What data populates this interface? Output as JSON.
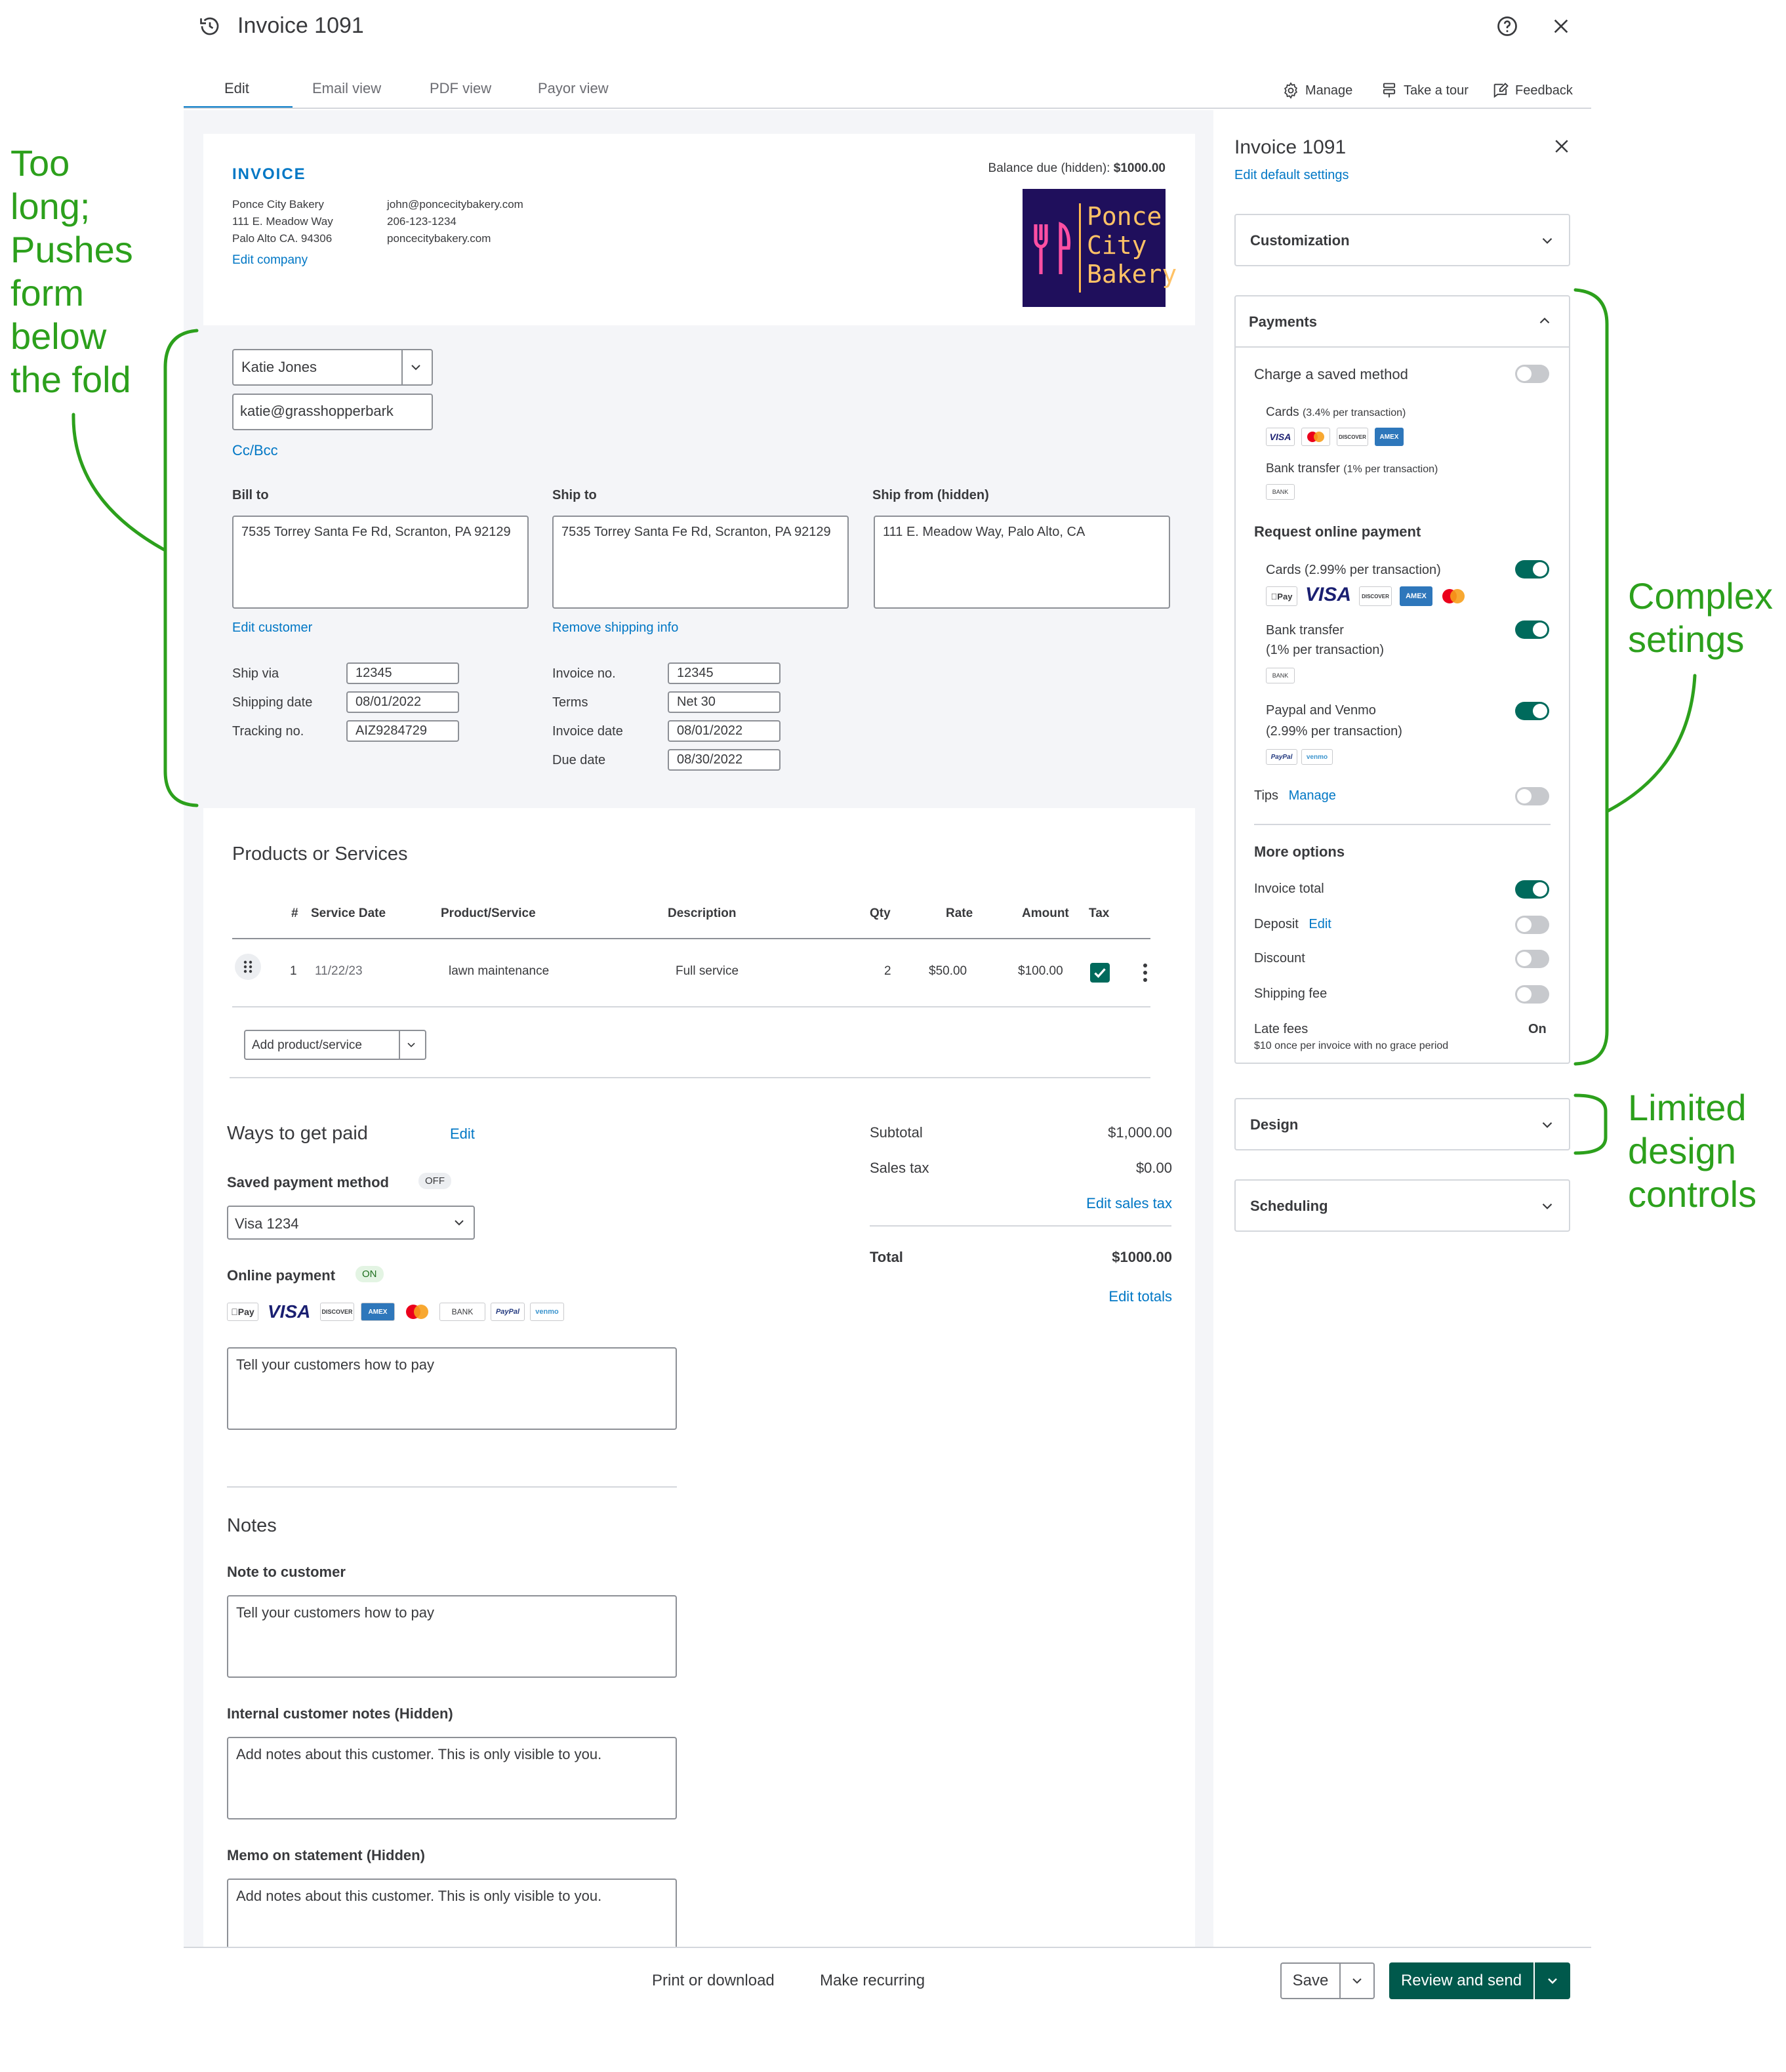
{
  "header": {
    "title": "Invoice 1091",
    "tabs": [
      "Edit",
      "Email view",
      "PDF view",
      "Payor view"
    ],
    "tools": {
      "manage": "Manage",
      "tour": "Take a tour",
      "feedback": "Feedback"
    }
  },
  "company": {
    "heading": "INVOICE",
    "name": "Ponce City Bakery",
    "address1": "111 E. Meadow Way",
    "address2": "Palo Alto CA. 94306",
    "email": "john@poncecitybakery.com",
    "phone": "206-123-1234",
    "site": "poncecitybakery.com",
    "edit": "Edit company",
    "balance_label": "Balance due (hidden):",
    "balance_value": "$1000.00",
    "logo": [
      "Ponce",
      "City",
      "Bakery"
    ]
  },
  "customer": {
    "name": "Katie Jones",
    "email": "katie@grasshopperbark",
    "ccbcc": "Cc/Bcc",
    "bill_to_label": "Bill to",
    "bill_to": "7535 Torrey Santa Fe Rd, Scranton, PA 92129",
    "ship_to_label": "Ship to",
    "ship_to": "7535 Torrey Santa Fe Rd, Scranton, PA 92129",
    "ship_from_label": "Ship from (hidden)",
    "ship_from": "111 E. Meadow Way, Palo Alto, CA",
    "edit_customer": "Edit customer",
    "remove_shipping": "Remove shipping info"
  },
  "shipping": {
    "via_label": "Ship via",
    "via": "12345",
    "date_label": "Shipping date",
    "date": "08/01/2022",
    "tracking_label": "Tracking no.",
    "tracking": "AIZ9284729"
  },
  "invoice_meta": {
    "no_label": "Invoice no.",
    "no": "12345",
    "terms_label": "Terms",
    "terms": "Net 30",
    "date_label": "Invoice date",
    "date": "08/01/2022",
    "due_label": "Due date",
    "due": "08/30/2022"
  },
  "products": {
    "title": "Products or Services",
    "columns": [
      "#",
      "Service Date",
      "Product/Service",
      "Description",
      "Qty",
      "Rate",
      "Amount",
      "Tax"
    ],
    "rows": [
      {
        "num": "1",
        "date": "11/22/23",
        "product": "lawn maintenance",
        "description": "Full service",
        "qty": "2",
        "rate": "$50.00",
        "amount": "$100.00"
      }
    ],
    "add": "Add product/service"
  },
  "payment": {
    "title": "Ways to get paid",
    "edit": "Edit",
    "saved_label": "Saved payment method",
    "saved_badge": "OFF",
    "saved_value": "Visa 1234",
    "online_label": "Online payment",
    "online_badge": "ON",
    "methods": [
      "Pay",
      "VISA",
      "DISCOVER",
      "AMEX",
      "BANK",
      "PayPal",
      "venmo"
    ],
    "instructions_placeholder": "Tell your customers how to pay"
  },
  "totals": {
    "subtotal_label": "Subtotal",
    "subtotal": "$1,000.00",
    "tax_label": "Sales tax",
    "tax": "$0.00",
    "edit_tax": "Edit sales tax",
    "total_label": "Total",
    "total": "$1000.00",
    "edit_totals": "Edit totals"
  },
  "notes": {
    "title": "Notes",
    "customer_label": "Note to customer",
    "customer_placeholder": "Tell your customers how to pay",
    "internal_label": "Internal customer notes (Hidden)",
    "internal_placeholder": "Add notes about this customer. This is only visible to you.",
    "memo_label": "Memo on statement (Hidden)",
    "memo_placeholder": "Add notes about this customer. This is only visible to you."
  },
  "sidebar": {
    "title": "Invoice 1091",
    "edit_defaults": "Edit default settings",
    "customization": "Customization",
    "payments": "Payments",
    "charge_saved": "Charge a saved method",
    "cards": "Cards",
    "cards_fee": "(3.4% per transaction)",
    "bank": "Bank transfer",
    "bank_fee": "(1% per transaction)",
    "request_online": "Request online payment",
    "online_cards": "Cards",
    "online_cards_fee": "(2.99% per transaction)",
    "online_bank": "Bank transfer",
    "online_bank_fee": "(1% per transaction)",
    "paypal": "Paypal and Venmo",
    "paypal_fee": "(2.99% per transaction)",
    "tips": "Tips",
    "tips_manage": "Manage",
    "more_options": "More options",
    "invoice_total": "Invoice total",
    "deposit": "Deposit",
    "deposit_edit": "Edit",
    "discount": "Discount",
    "shipping_fee": "Shipping fee",
    "late_fees": "Late fees",
    "late_fees_value": "On",
    "late_fees_desc": "$10 once per invoice with no grace period",
    "design": "Design",
    "scheduling": "Scheduling"
  },
  "footer": {
    "print": "Print or download",
    "recurring": "Make recurring",
    "save": "Save",
    "review": "Review and send"
  },
  "annotations": {
    "left": [
      "Too",
      "long;",
      "Pushes",
      "form",
      "below",
      "the fold"
    ],
    "right_top": [
      "Complex",
      "setings"
    ],
    "right_bottom": [
      "Limited",
      "design",
      "controls"
    ]
  },
  "colors": {
    "accent_blue": "#0077c5",
    "toggle_on": "#006a5c",
    "annotation_green": "#2ca01c",
    "primary_button": "#00594c",
    "logo_bg": "#1f0f5c"
  }
}
